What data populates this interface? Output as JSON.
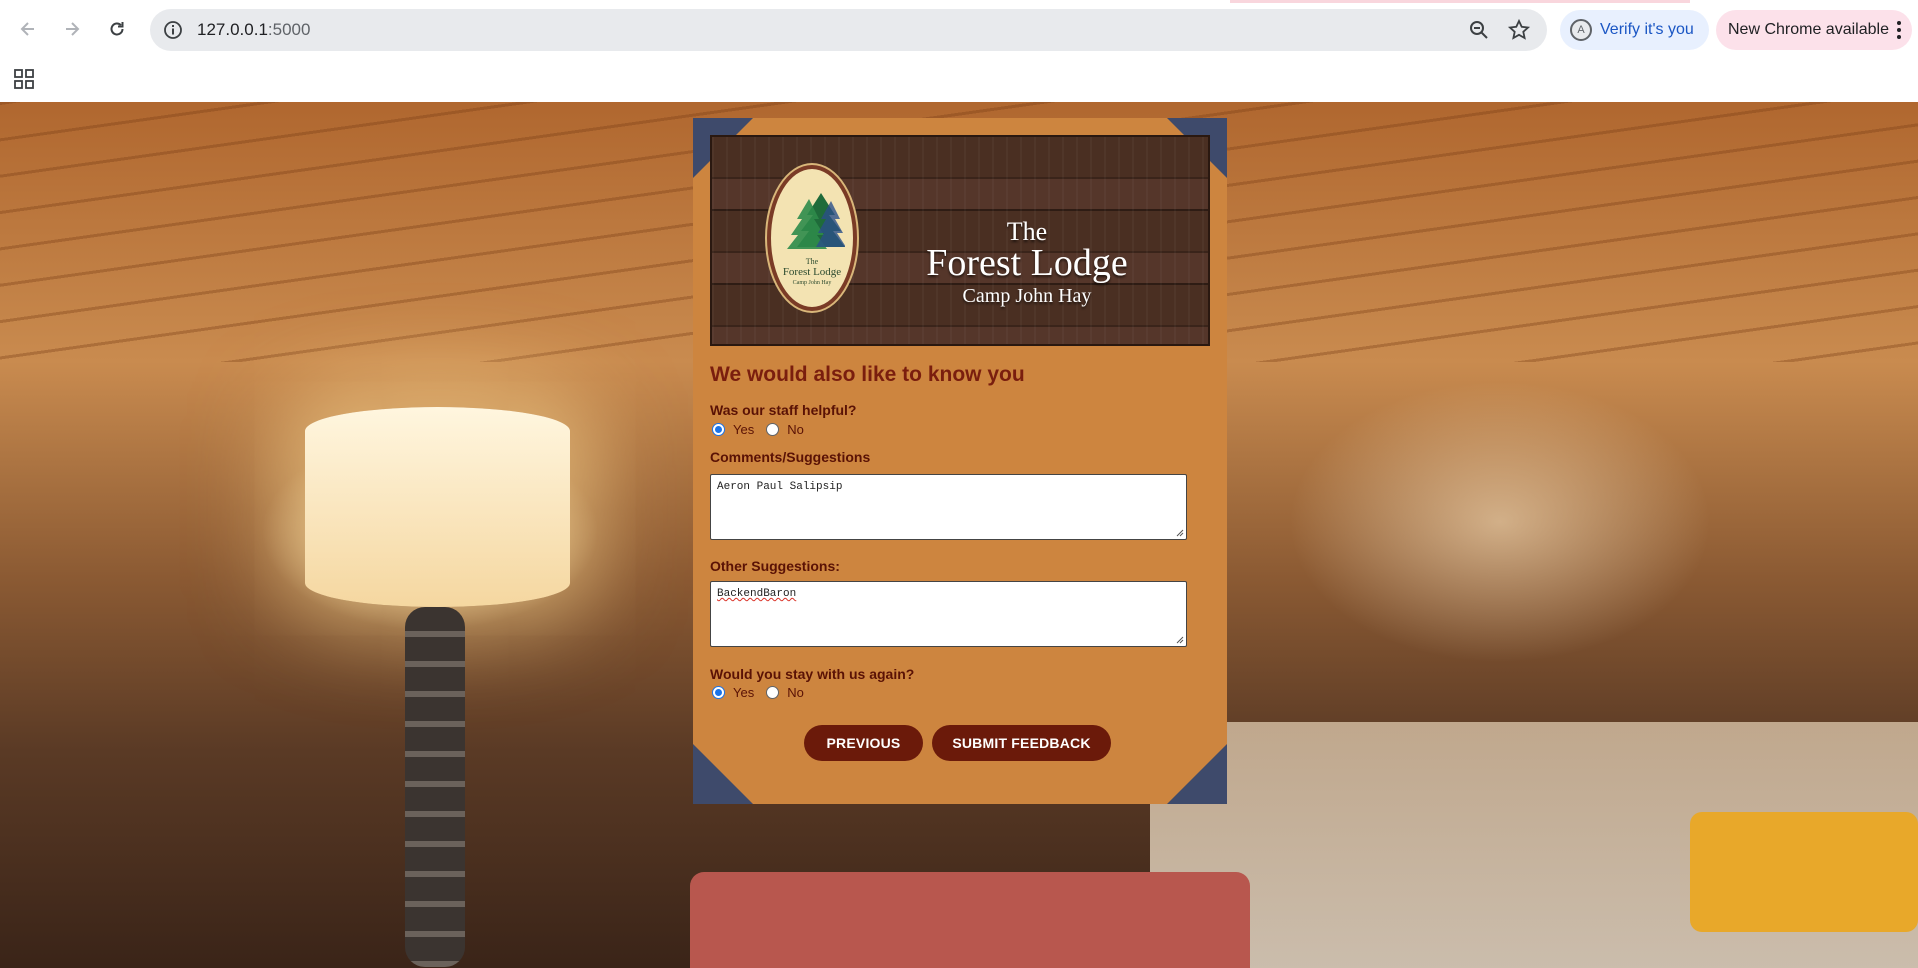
{
  "browser": {
    "url_host": "127.0.0.1",
    "url_port": ":5000",
    "verify_label": "Verify it's you",
    "verify_avatar": "A",
    "update_label": "New Chrome available"
  },
  "icons": {
    "back": "arrow-left-icon",
    "forward": "arrow-right-icon",
    "reload": "reload-icon",
    "site_info": "info-icon",
    "zoom": "zoom-icon",
    "bookmark": "star-icon",
    "menu": "kebab-menu-icon",
    "apps": "apps-grid-icon"
  },
  "banner": {
    "logo_small_the": "The",
    "logo_small_name": "Forest Lodge",
    "logo_small_sub": "Camp John Hay",
    "title_the": "The",
    "title_name": "Forest Lodge",
    "title_sub": "Camp John Hay"
  },
  "form": {
    "heading": "We would also like to know you",
    "staff_question": "Was our staff helpful?",
    "staff_options": {
      "yes": "Yes",
      "no": "No",
      "selected": "Yes"
    },
    "comments_label": "Comments/Suggestions",
    "comments_value": "Aeron Paul Salipsip",
    "other_label": "Other Suggestions:",
    "other_value": "BackendBaron",
    "stay_question": "Would you stay with us again?",
    "stay_options": {
      "yes": "Yes",
      "no": "No",
      "selected": "Yes"
    },
    "prev_button": "PREVIOUS",
    "submit_button": "SUBMIT FEEDBACK"
  },
  "colors": {
    "card": "#cd853f",
    "heading": "#7a1e0e",
    "button": "#6b1a0a",
    "corner": "#3e4a6b"
  }
}
